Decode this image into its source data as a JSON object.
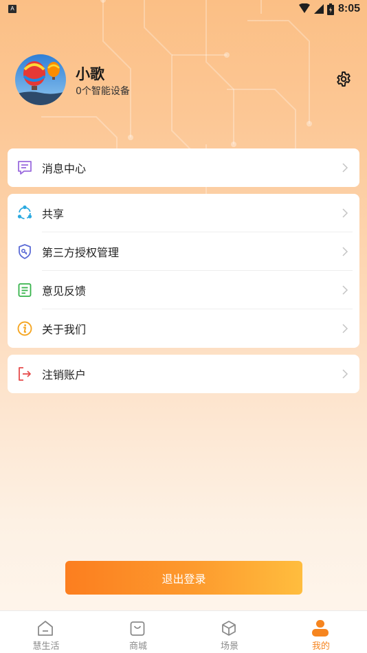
{
  "status_bar": {
    "indicator": "A",
    "time": "8:05"
  },
  "profile": {
    "name": "小歌",
    "device_count": "0个智能设备"
  },
  "menu": {
    "card1": [
      {
        "label": "消息中心",
        "icon": "message-icon"
      }
    ],
    "card2": [
      {
        "label": "共享",
        "icon": "share-icon"
      },
      {
        "label": "第三方授权管理",
        "icon": "shield-key-icon"
      },
      {
        "label": "意见反馈",
        "icon": "feedback-icon"
      },
      {
        "label": "关于我们",
        "icon": "info-icon"
      }
    ],
    "card3": [
      {
        "label": "注销账户",
        "icon": "logout-account-icon"
      }
    ]
  },
  "logout_button": "退出登录",
  "tabs": [
    {
      "label": "慧生活",
      "icon": "home-icon",
      "active": false
    },
    {
      "label": "商城",
      "icon": "shopping-bag-icon",
      "active": false
    },
    {
      "label": "场景",
      "icon": "cube-icon",
      "active": false
    },
    {
      "label": "我的",
      "icon": "user-icon",
      "active": true
    }
  ],
  "colors": {
    "accent": "#f6851f",
    "button_start": "#fc7e1f",
    "button_end": "#ffbd3e",
    "tab_inactive": "#8a8a8a"
  }
}
